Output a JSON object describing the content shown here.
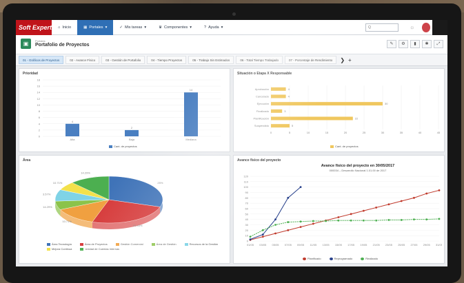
{
  "app": {
    "logo": "Soft Expert",
    "nav": [
      {
        "label": "Inicio",
        "icon": "home-icon"
      },
      {
        "label": "Portales",
        "icon": "grid-icon"
      },
      {
        "label": "Mis tareas",
        "icon": "check-icon"
      },
      {
        "label": "Componentes",
        "icon": "trophy-icon"
      },
      {
        "label": "Ayuda",
        "icon": "help-icon"
      }
    ],
    "search_placeholder": "Q"
  },
  "page": {
    "subtitle": "Portales",
    "title": "Portafolio de Proyectos"
  },
  "tabs": [
    "01 - Gráficos de Proyectos",
    "02 - Avance Físico",
    "03 - Gestión de Portafolio",
    "04 - Tiempo Proyectos",
    "05 - Trabajo Sin Estimados",
    "06 - Total Tiempo Trabajado",
    "07 - Porcentaje de Rendimiento"
  ],
  "panels": {
    "prioridad": {
      "title": "Prioridad",
      "legend": "Cant. de proyectos"
    },
    "situacion": {
      "title": "Situación o Etapa X Responsable",
      "legend": "Cant. de proyectos"
    },
    "area": {
      "title": "Área",
      "legend": [
        "Área Tecnología",
        "Área de Proyectos",
        "Gestión Comercial",
        "Área de Gestión",
        "Recursos de la Gestión",
        "Mejora Continua",
        "Unidad de Cuentas Internas"
      ]
    },
    "avance": {
      "title": "Avance físico del proyecto",
      "chart_title": "Avance físico del proyecto en 30/05/2017",
      "chart_subtitle": "000034 – Desarrollo Nacional 1.01.00 de 2017",
      "legend": [
        "Planificado",
        "Reprogramado",
        "Realizado"
      ]
    }
  },
  "chart_data": [
    {
      "type": "bar",
      "title": "Prioridad",
      "categories": [
        "Alta",
        "Baja",
        "Mediana"
      ],
      "values": [
        4,
        2,
        14
      ],
      "ylim": [
        0,
        18
      ],
      "yticks": [
        0,
        2,
        4,
        6,
        8,
        10,
        12,
        14,
        16,
        18
      ],
      "color": "#4a7fc1"
    },
    {
      "type": "bar",
      "orientation": "horizontal",
      "title": "Situación o Etapa X Responsable",
      "categories": [
        "Aprobación",
        "Cancelado",
        "Ejecución",
        "Finalizado",
        "Planificación",
        "Suspendido"
      ],
      "values": [
        4,
        4,
        30,
        3,
        22,
        5
      ],
      "xlim": [
        0,
        45
      ],
      "xticks": [
        0,
        5,
        10,
        15,
        20,
        25,
        30,
        35,
        40,
        45
      ],
      "color": "#f0c75e"
    },
    {
      "type": "pie",
      "title": "Área",
      "labels": [
        "Área Tecnología",
        "Área de Proyectos",
        "Gestión Comercial",
        "Área de Gestión",
        "Recursos de la Gestión",
        "Mejora Continua",
        "Unidad de Cuentas Internas"
      ],
      "values": [
        30,
        25,
        13,
        6,
        8,
        6,
        12
      ],
      "colors": [
        "#3f73b8",
        "#d63b3b",
        "#f0a040",
        "#8bc34a",
        "#7fd3e6",
        "#f3e14b",
        "#4caf50"
      ],
      "data_labels": [
        "25%",
        "21.43%",
        "10.71%",
        "14.29%",
        "3.57%",
        "10.71%",
        "14.29%"
      ]
    },
    {
      "type": "line",
      "title": "Avance físico del proyecto en 30/05/2017",
      "x": [
        "01/05",
        "03/05",
        "05/05",
        "07/05",
        "09/05",
        "11/05",
        "13/05",
        "15/05",
        "17/05",
        "19/05",
        "21/05",
        "23/05",
        "25/05",
        "27/05",
        "29/05",
        "31/05"
      ],
      "series": [
        {
          "name": "Planificado",
          "color": "#c0392b",
          "values": [
            2,
            8,
            14,
            20,
            26,
            32,
            38,
            44,
            50,
            56,
            62,
            68,
            74,
            80,
            88,
            94
          ]
        },
        {
          "name": "Reprogramado",
          "color": "#27408b",
          "values": [
            3,
            12,
            40,
            80,
            100,
            null,
            null,
            null,
            null,
            null,
            null,
            null,
            null,
            null,
            null,
            null
          ]
        },
        {
          "name": "Realizado",
          "color": "#4caf50",
          "values": [
            8,
            20,
            30,
            35,
            36,
            37,
            37,
            38,
            38,
            38,
            38,
            39,
            39,
            40,
            40,
            41
          ]
        }
      ],
      "ylim": [
        0,
        120
      ],
      "yticks": [
        0,
        10,
        20,
        30,
        40,
        50,
        60,
        70,
        80,
        90,
        100,
        110,
        120
      ]
    }
  ]
}
